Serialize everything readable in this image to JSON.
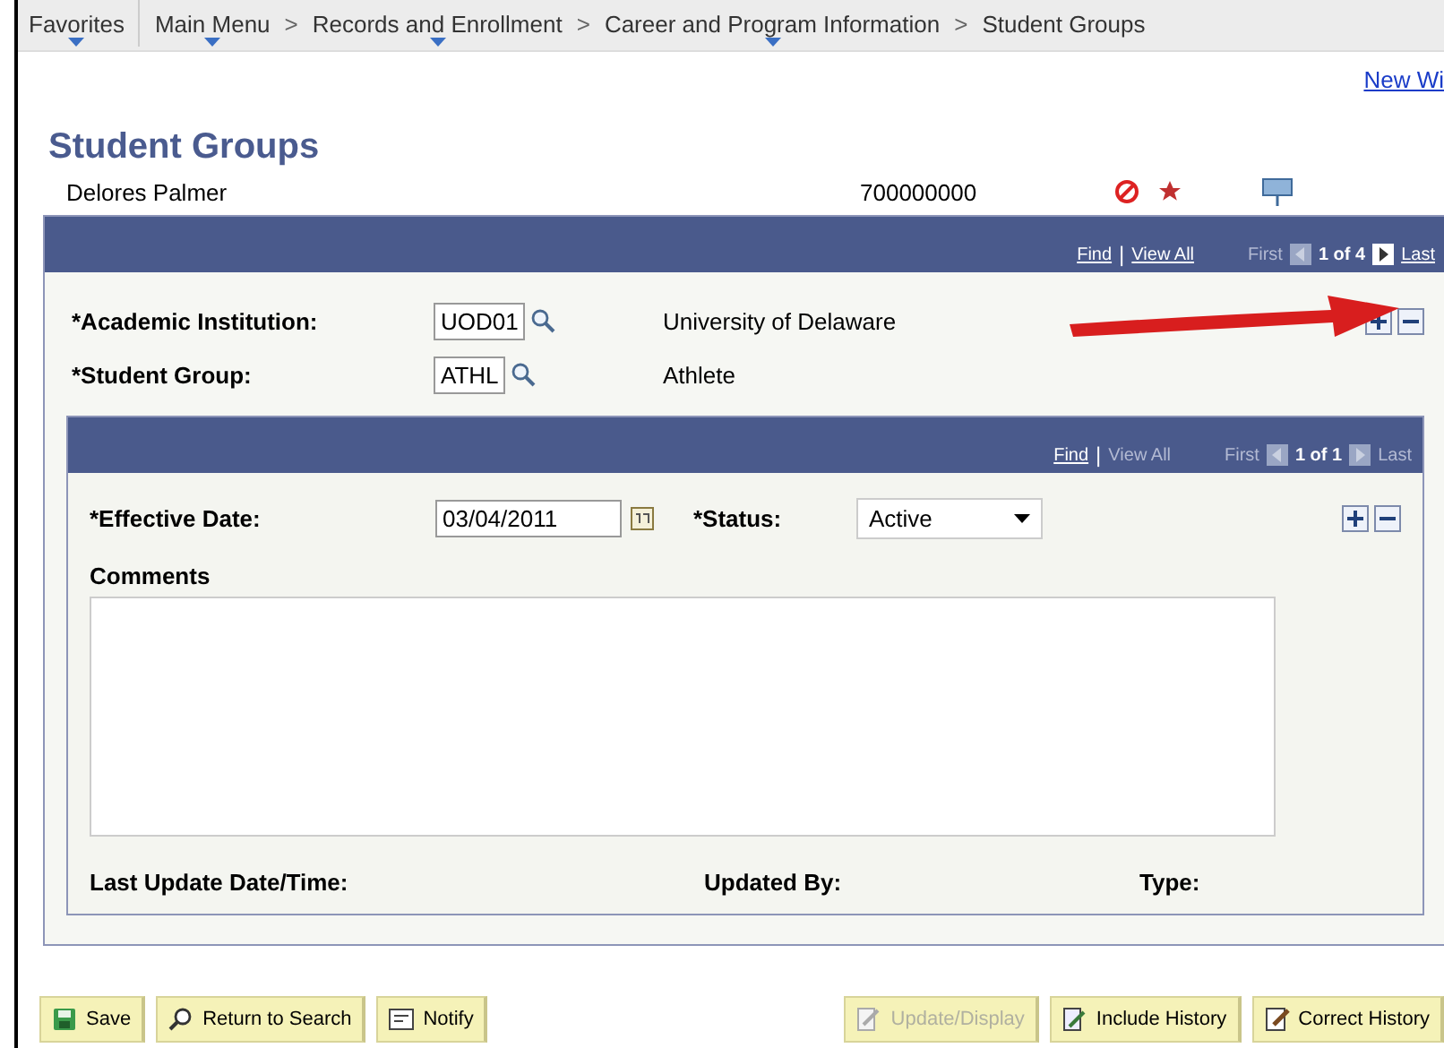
{
  "breadcrumbs": [
    {
      "label": "Favorites",
      "dropdown": true
    },
    {
      "label": "Main Menu",
      "dropdown": true
    },
    {
      "separator": ">",
      "label": "Records and Enrollment",
      "dropdown": true
    },
    {
      "separator": ">",
      "label": "Career and Program Information",
      "dropdown": true
    },
    {
      "separator": ">",
      "label": "Student Groups",
      "dropdown": false
    }
  ],
  "new_window_link": "New Wi",
  "page_title": "Student Groups",
  "person": {
    "name": "Delores Palmer",
    "id": "700000000"
  },
  "outer_nav": {
    "find": "Find",
    "divider": "|",
    "view_all": {
      "label": "View All",
      "disabled": false
    },
    "first": {
      "label": "First",
      "disabled": true
    },
    "prev_disabled": true,
    "count": "1 of 4",
    "next_disabled": false,
    "last": {
      "label": "Last",
      "disabled": false
    }
  },
  "fields": [
    {
      "label": "*Academic Institution:",
      "value": "UOD01",
      "description": "University of Delaware"
    },
    {
      "label": "*Student Group:",
      "value": "ATHL",
      "description": "Athlete"
    }
  ],
  "inner_nav": {
    "find": "Find",
    "divider": "|",
    "view_all": {
      "label": "View All",
      "disabled": true
    },
    "first": {
      "label": "First",
      "disabled": true
    },
    "prev_disabled": true,
    "count": "1 of 1",
    "next_disabled": true,
    "last": {
      "label": "Last",
      "disabled": true
    }
  },
  "effective_date": {
    "label": "*Effective Date:",
    "value": "03/04/2011"
  },
  "status": {
    "label": "*Status:",
    "value": "Active"
  },
  "comments": {
    "label": "Comments"
  },
  "footer_labels": [
    "Last Update Date/Time:",
    "Updated By:",
    "Type:"
  ],
  "buttons": [
    {
      "kind": "save",
      "label": "Save",
      "disabled": false
    },
    {
      "kind": "search",
      "label": "Return to Search",
      "disabled": false
    },
    {
      "kind": "notify",
      "label": "Notify",
      "disabled": false
    },
    {
      "kind": "update",
      "label": "Update/Display",
      "disabled": true
    },
    {
      "kind": "include",
      "label": "Include History",
      "disabled": false
    },
    {
      "kind": "correct",
      "label": "Correct History",
      "disabled": false
    }
  ]
}
